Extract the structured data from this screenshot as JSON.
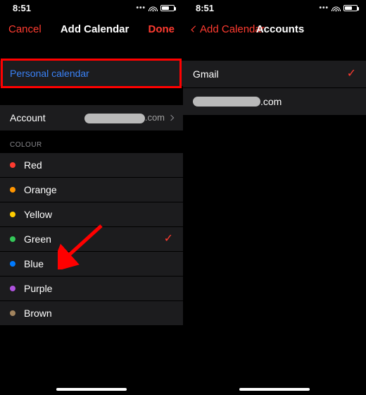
{
  "status": {
    "time": "8:51"
  },
  "left": {
    "nav": {
      "cancel": "Cancel",
      "title": "Add Calendar",
      "done": "Done"
    },
    "calendar_name": "Personal calendar",
    "account_label": "Account",
    "account_value_suffix": ".com",
    "colour_header": "COLOUR",
    "colours": [
      {
        "name": "Red",
        "hex": "#ff3b30",
        "selected": false
      },
      {
        "name": "Orange",
        "hex": "#ff9500",
        "selected": false
      },
      {
        "name": "Yellow",
        "hex": "#ffcc00",
        "selected": false
      },
      {
        "name": "Green",
        "hex": "#34c759",
        "selected": true
      },
      {
        "name": "Blue",
        "hex": "#007aff",
        "selected": false
      },
      {
        "name": "Purple",
        "hex": "#af52de",
        "selected": false
      },
      {
        "name": "Brown",
        "hex": "#a2845e",
        "selected": false
      }
    ]
  },
  "right": {
    "nav": {
      "back": "Add Calendar",
      "title": "Accounts"
    },
    "accounts": [
      {
        "name": "Gmail",
        "selected": true,
        "redacted": false
      },
      {
        "name": "",
        "suffix": ".com",
        "selected": false,
        "redacted": true
      }
    ]
  }
}
